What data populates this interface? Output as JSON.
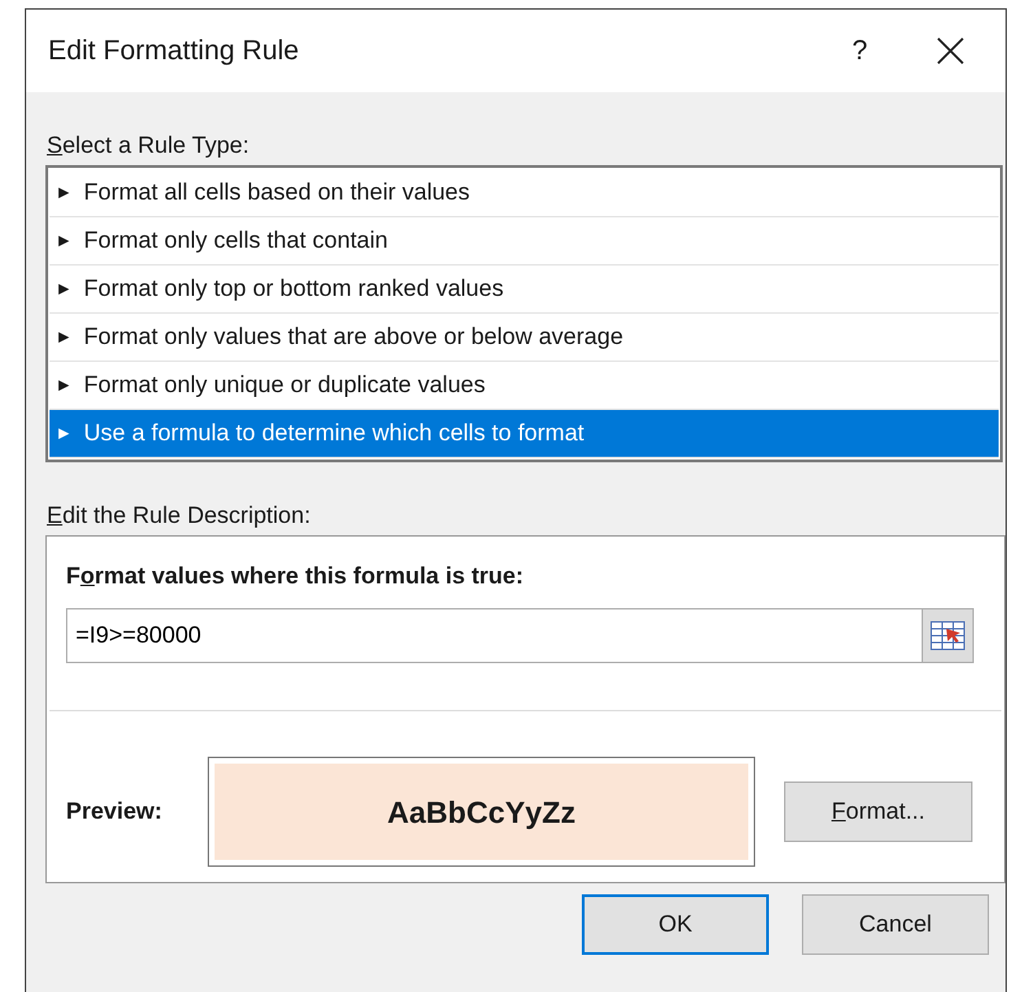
{
  "window": {
    "title": "Edit Formatting Rule",
    "help": "?"
  },
  "rule_type": {
    "label": {
      "key": "S",
      "after": "elect a Rule Type:"
    },
    "items": [
      {
        "marker": "►",
        "label": "Format all cells based on their values",
        "selected": false
      },
      {
        "marker": "►",
        "label": "Format only cells that contain",
        "selected": false
      },
      {
        "marker": "►",
        "label": "Format only top or bottom ranked values",
        "selected": false
      },
      {
        "marker": "►",
        "label": "Format only values that are above or below average",
        "selected": false
      },
      {
        "marker": "►",
        "label": "Format only unique or duplicate values",
        "selected": false
      },
      {
        "marker": "►",
        "label": "Use a formula to determine which cells to format",
        "selected": true
      }
    ]
  },
  "description": {
    "label": {
      "key": "E",
      "after": "dit the Rule Description:"
    },
    "formula_label": {
      "before": "F",
      "key": "o",
      "after": "rmat values where this formula is true:"
    },
    "formula": "=I9>=80000",
    "preview_label": "Preview:",
    "preview_text": "AaBbCcYyZz",
    "format_button": {
      "key": "F",
      "after": "ormat..."
    }
  },
  "buttons": [
    {
      "label": "OK",
      "default": true
    },
    {
      "label": "Cancel",
      "default": false
    }
  ]
}
